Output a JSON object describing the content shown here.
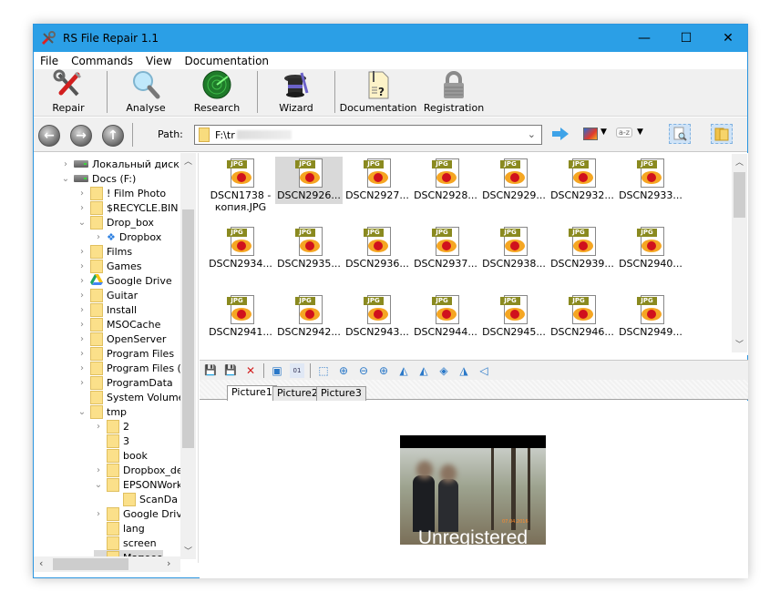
{
  "window": {
    "title": "RS File Repair 1.1",
    "controls": {
      "minimize": "—",
      "maximize": "☐",
      "close": "✕"
    }
  },
  "menu": [
    "File",
    "Commands",
    "View",
    "Documentation"
  ],
  "toolbar": {
    "buttons": [
      {
        "label": "Repair",
        "icon": "repair-tools-icon"
      },
      {
        "label": "Analyse",
        "icon": "magnifier-icon"
      },
      {
        "label": "Research",
        "icon": "radar-icon"
      },
      {
        "label": "Wizard",
        "icon": "wizard-hat-icon"
      },
      {
        "label": "Documentation",
        "icon": "documentation-icon"
      },
      {
        "label": "Registration",
        "icon": "lock-icon"
      }
    ]
  },
  "navbar": {
    "back": "←",
    "forward": "→",
    "up": "↑",
    "path_label": "Path:",
    "path_value": "F:\\tr",
    "go_icon": "go-arrow-icon",
    "view_mode_icon": "thumbnail-view-icon",
    "sort_icon": "sort-az-icon",
    "sort_label": "a-z",
    "preview_toggle_icon": "preview-pane-icon",
    "folders_toggle_icon": "folders-pane-icon"
  },
  "tree": {
    "items": [
      {
        "label": "Локальный диск (C",
        "type": "drive",
        "level": 0,
        "expander": "collapsed"
      },
      {
        "label": "Docs (F:)",
        "type": "drive",
        "level": 0,
        "expander": "expanded"
      },
      {
        "label": "! Film Photo",
        "type": "folder",
        "level": 1,
        "expander": "collapsed"
      },
      {
        "label": "$RECYCLE.BIN",
        "type": "folder",
        "level": 1,
        "expander": "collapsed"
      },
      {
        "label": "Drop_box",
        "type": "folder",
        "level": 1,
        "expander": "expanded"
      },
      {
        "label": "Dropbox",
        "type": "dropbox",
        "level": 2,
        "expander": "collapsed"
      },
      {
        "label": "Films",
        "type": "folder",
        "level": 1,
        "expander": "collapsed"
      },
      {
        "label": "Games",
        "type": "folder",
        "level": 1,
        "expander": "collapsed"
      },
      {
        "label": "Google Drive",
        "type": "gdrive",
        "level": 1,
        "expander": "collapsed"
      },
      {
        "label": "Guitar",
        "type": "folder",
        "level": 1,
        "expander": "collapsed"
      },
      {
        "label": "Install",
        "type": "folder",
        "level": 1,
        "expander": "collapsed"
      },
      {
        "label": "MSOCache",
        "type": "folder",
        "level": 1,
        "expander": "collapsed"
      },
      {
        "label": "OpenServer",
        "type": "folder",
        "level": 1,
        "expander": "collapsed"
      },
      {
        "label": "Program Files",
        "type": "folder",
        "level": 1,
        "expander": "collapsed"
      },
      {
        "label": "Program Files (x",
        "type": "folder",
        "level": 1,
        "expander": "collapsed"
      },
      {
        "label": "ProgramData",
        "type": "folder",
        "level": 1,
        "expander": "collapsed"
      },
      {
        "label": "System Volume",
        "type": "folder",
        "level": 1,
        "expander": "none"
      },
      {
        "label": "tmp",
        "type": "folder",
        "level": 1,
        "expander": "expanded"
      },
      {
        "label": "2",
        "type": "folder",
        "level": 2,
        "expander": "collapsed"
      },
      {
        "label": "3",
        "type": "folder",
        "level": 2,
        "expander": "none"
      },
      {
        "label": "book",
        "type": "folder",
        "level": 2,
        "expander": "none"
      },
      {
        "label": "Dropbox_de",
        "type": "folder",
        "level": 2,
        "expander": "collapsed"
      },
      {
        "label": "EPSONWork",
        "type": "folder",
        "level": 2,
        "expander": "expanded"
      },
      {
        "label": "ScanDa",
        "type": "folder",
        "level": 3,
        "expander": "none"
      },
      {
        "label": "Google Driv",
        "type": "folder",
        "level": 2,
        "expander": "collapsed"
      },
      {
        "label": "lang",
        "type": "folder",
        "level": 2,
        "expander": "none"
      },
      {
        "label": "screen",
        "type": "folder",
        "level": 2,
        "expander": "none"
      },
      {
        "label": "Мапеео",
        "type": "folder",
        "level": 2,
        "expander": "none",
        "selected": true
      }
    ]
  },
  "files": {
    "type_tag": "JPG",
    "items": [
      {
        "name": "DSCN1738 - копия.JPG",
        "selected": false
      },
      {
        "name": "DSCN2926...",
        "selected": true
      },
      {
        "name": "DSCN2927...",
        "selected": false
      },
      {
        "name": "DSCN2928...",
        "selected": false
      },
      {
        "name": "DSCN2929...",
        "selected": false
      },
      {
        "name": "DSCN2932...",
        "selected": false
      },
      {
        "name": "DSCN2933...",
        "selected": false
      },
      {
        "name": "DSCN2934...",
        "selected": false
      },
      {
        "name": "DSCN2935...",
        "selected": false
      },
      {
        "name": "DSCN2936...",
        "selected": false
      },
      {
        "name": "DSCN2937...",
        "selected": false
      },
      {
        "name": "DSCN2938...",
        "selected": false
      },
      {
        "name": "DSCN2939...",
        "selected": false
      },
      {
        "name": "DSCN2940...",
        "selected": false
      },
      {
        "name": "DSCN2941...",
        "selected": false
      },
      {
        "name": "DSCN2942...",
        "selected": false
      },
      {
        "name": "DSCN2943...",
        "selected": false
      },
      {
        "name": "DSCN2944...",
        "selected": false
      },
      {
        "name": "DSCN2945...",
        "selected": false
      },
      {
        "name": "DSCN2946...",
        "selected": false
      },
      {
        "name": "DSCN2949...",
        "selected": false
      }
    ]
  },
  "image_toolbar": [
    {
      "name": "save-icon",
      "glyph": "💾"
    },
    {
      "name": "save-all-icon",
      "glyph": "💾"
    },
    {
      "name": "delete-icon",
      "glyph": "✕"
    },
    {
      "sep": true
    },
    {
      "name": "image-info-icon",
      "glyph": "▣"
    },
    {
      "name": "hex-view-icon",
      "glyph": "01"
    },
    {
      "sep": true
    },
    {
      "name": "fit-window-icon",
      "glyph": "⬚"
    },
    {
      "name": "actual-size-icon",
      "glyph": "⊕"
    },
    {
      "name": "zoom-out-icon",
      "glyph": "⊖"
    },
    {
      "name": "zoom-in-icon",
      "glyph": "⊕"
    },
    {
      "name": "rotate-left-icon",
      "glyph": "◭"
    },
    {
      "name": "rotate-right-icon",
      "glyph": "◭"
    },
    {
      "name": "rotate-free-icon",
      "glyph": "◈"
    },
    {
      "name": "flip-horizontal-icon",
      "glyph": "◮"
    },
    {
      "name": "flip-vertical-icon",
      "glyph": "◁"
    }
  ],
  "preview": {
    "tabs": [
      {
        "label": "Picture1",
        "active": true
      },
      {
        "label": "Picture2",
        "active": false
      },
      {
        "label": "Picture3",
        "active": false
      }
    ],
    "watermark": "Unregistered"
  }
}
